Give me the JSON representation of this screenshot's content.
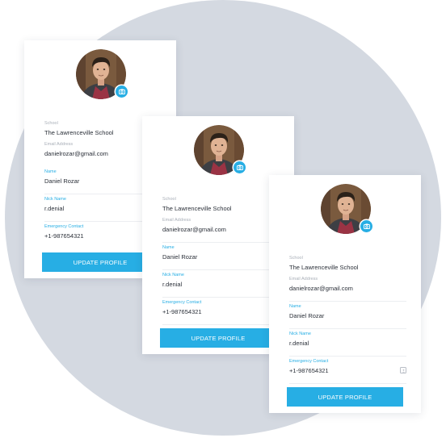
{
  "colors": {
    "accent": "#27aee4",
    "background_circle": "#d4d9e1",
    "card": "#ffffff",
    "label": "#a9afb8",
    "value": "#2a2f38"
  },
  "icons": {
    "camera": "camera-icon",
    "contact": "contact-book-icon"
  },
  "profile": {
    "school_label": "School",
    "school_value": "The Lawrenceville School",
    "email_label": "Email Address",
    "email_value": "danielrozar@gmail.com",
    "name_label": "Name",
    "name_value": "Daniel Rozar",
    "nick_label": "Nick Name",
    "nick_value": "r.denial",
    "emergency_label": "Emergency Contact",
    "emergency_value": "+1-987654321",
    "button_label": "UPDATE PROFILE"
  }
}
